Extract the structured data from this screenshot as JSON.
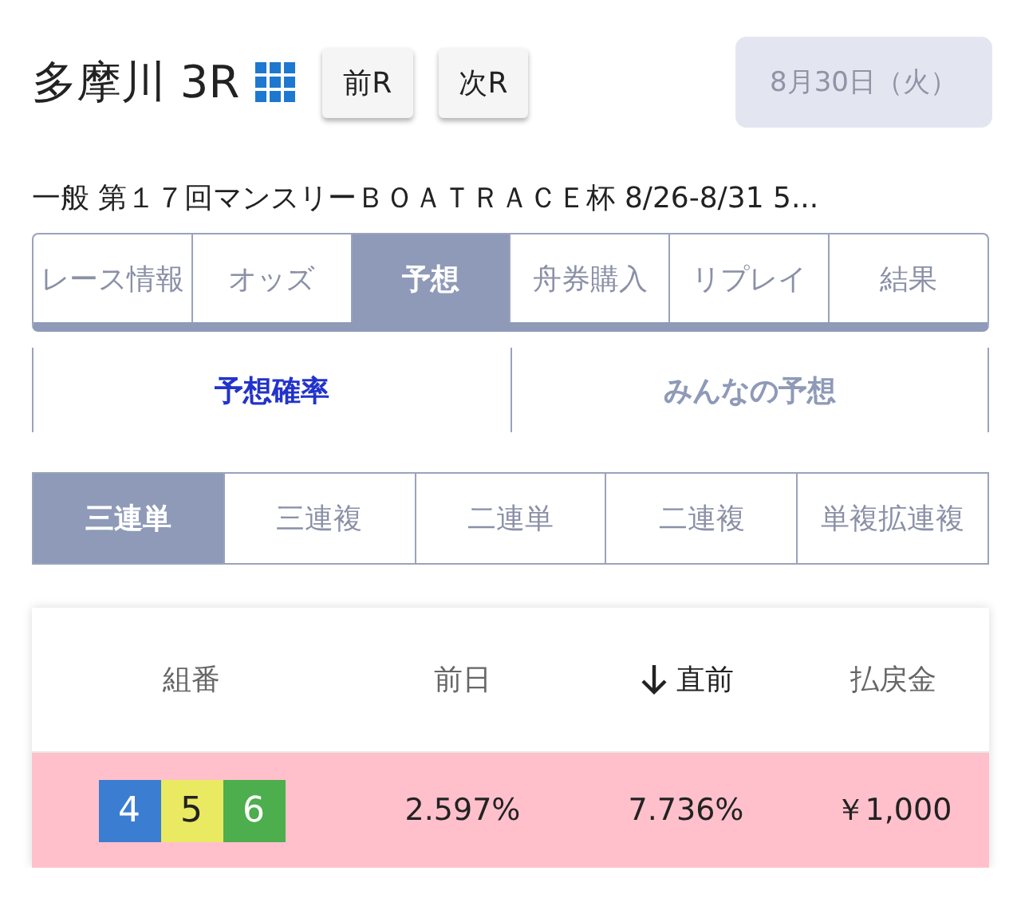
{
  "header": {
    "title": "多摩川 3R",
    "buttons": [
      "前R",
      "次R"
    ],
    "date": "8月30日（火）"
  },
  "race_name": "一般 第１７回マンスリーＢＯＡＴＲＡＣＥ杯 8/26-8/31 5...",
  "tabs": [
    {
      "label": "レース情報",
      "selected": false
    },
    {
      "label": "オッズ",
      "selected": false
    },
    {
      "label": "予想",
      "selected": true
    },
    {
      "label": "舟券購入",
      "selected": false
    },
    {
      "label": "リプレイ",
      "selected": false
    },
    {
      "label": "結果",
      "selected": false
    }
  ],
  "sub_tabs": [
    {
      "label": "予想確率",
      "selected": true
    },
    {
      "label": "みんなの予想",
      "selected": false
    }
  ],
  "bet_types": [
    {
      "label": "三連単",
      "selected": true
    },
    {
      "label": "三連複",
      "selected": false
    },
    {
      "label": "二連単",
      "selected": false
    },
    {
      "label": "二連複",
      "selected": false
    },
    {
      "label": "単複拡連複",
      "selected": false
    }
  ],
  "table": {
    "columns": [
      {
        "label": "組番",
        "sorted": false
      },
      {
        "label": "前日",
        "sorted": false
      },
      {
        "label": "直前",
        "sorted": true
      },
      {
        "label": "払戻金",
        "sorted": false
      }
    ],
    "rows": [
      {
        "combo": [
          {
            "number": "4",
            "color": "#3b7dd0"
          },
          {
            "number": "5",
            "color": "#eaea62"
          },
          {
            "number": "6",
            "color": "#4cae4c"
          }
        ],
        "previous_day": "2.597%",
        "latest": "7.736%",
        "payout": "￥1,000",
        "highlighted": true
      }
    ]
  }
}
